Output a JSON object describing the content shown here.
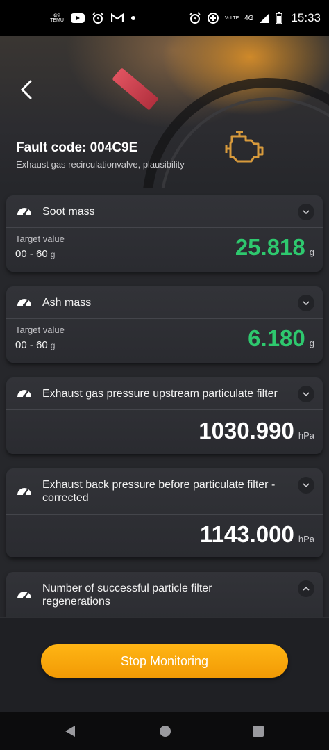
{
  "status_bar": {
    "notif_small_text": "ଶିଳି TEMU",
    "time": "15:33",
    "network": "4G",
    "volte": "VoLTE",
    "icons": [
      "temu-icon",
      "youtube-icon",
      "alarm-icon",
      "gmail-icon",
      "dot-icon",
      "alarm-icon",
      "data-saver-icon",
      "volte-icon",
      "signal-icon",
      "battery-icon"
    ]
  },
  "header": {
    "fault_title": "Fault code: 004C9E",
    "fault_description": "Exhaust gas recirculationvalve, plausibility"
  },
  "cards": [
    {
      "title": "Soot mass",
      "target_label": "Target value",
      "target_range": "00 - 60",
      "target_unit": "g",
      "value": "25.818",
      "unit": "g",
      "color": "#2ec86e",
      "expanded": false
    },
    {
      "title": "Ash mass",
      "target_label": "Target value",
      "target_range": "00 - 60",
      "target_unit": "g",
      "value": "6.180",
      "unit": "g",
      "color": "#2ec86e",
      "expanded": false
    },
    {
      "title": "Exhaust gas pressure upstream particulate filter",
      "value": "1030.990",
      "unit": "hPa",
      "color": "#ffffff",
      "expanded": false
    },
    {
      "title": "Exhaust back pressure before particulate filter - corrected",
      "value": "1143.000",
      "unit": "hPa",
      "color": "#ffffff",
      "expanded": false
    },
    {
      "title": "Number of successful particle filter regenerations",
      "expanded": true
    }
  ],
  "actions": {
    "stop_label": "Stop Monitoring"
  },
  "colors": {
    "accent": "#f7a50c",
    "good": "#2ec86e",
    "background": "#26272b"
  }
}
